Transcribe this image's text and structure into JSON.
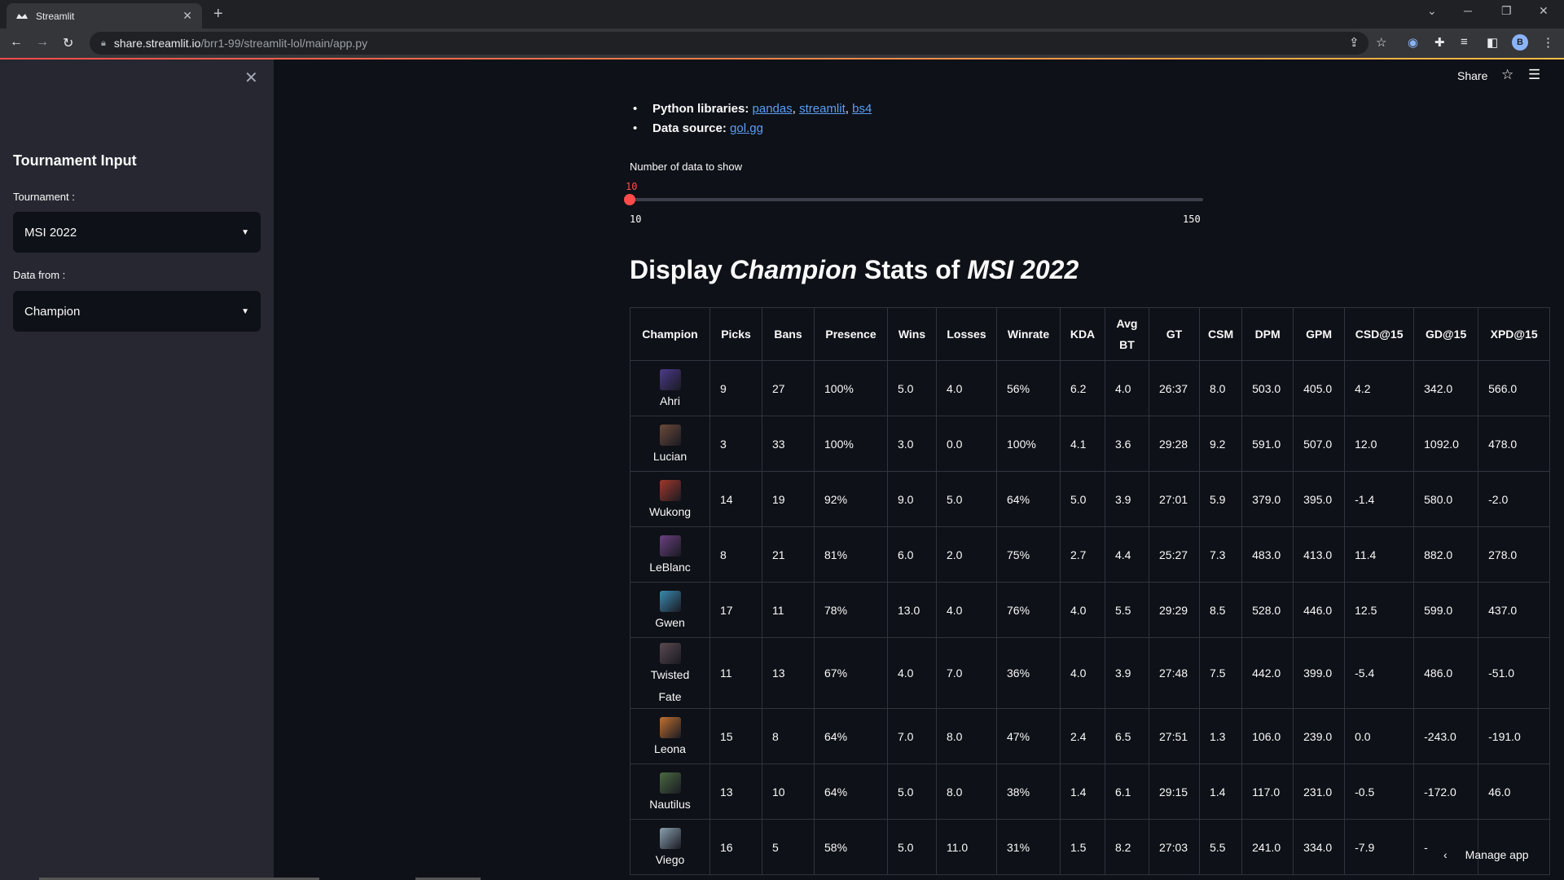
{
  "browser": {
    "tab_title": "Streamlit",
    "url_host": "share.streamlit.io",
    "url_path": "/brr1-99/streamlit-lol/main/app.py",
    "profile_initial": "B"
  },
  "sidebar": {
    "title": "Tournament Input",
    "tournament_label": "Tournament :",
    "tournament_value": "MSI 2022",
    "data_from_label": "Data from :",
    "data_from_value": "Champion"
  },
  "header": {
    "share_label": "Share"
  },
  "info": {
    "libraries_label": "Python libraries:",
    "lib1": "pandas",
    "lib2": "streamlit",
    "lib3": "bs4",
    "comma": ",",
    "source_label": "Data source:",
    "source_link": "gol.gg"
  },
  "slider": {
    "label": "Number of data to show",
    "value": "10",
    "min": "10",
    "max": "150",
    "fraction": 0
  },
  "heading": {
    "prefix": "Display ",
    "entity": "Champion",
    "middle": " Stats of ",
    "tournament": "MSI 2022"
  },
  "table": {
    "columns": [
      "Champion",
      "Picks",
      "Bans",
      "Presence",
      "Wins",
      "Losses",
      "Winrate",
      "KDA",
      "Avg BT",
      "GT",
      "CSM",
      "DPM",
      "GPM",
      "CSD@15",
      "GD@15",
      "XPD@15"
    ],
    "rows": [
      {
        "champion": "Ahri",
        "portrait": "#4b3a8a",
        "cells": [
          "9",
          "27",
          "100%",
          "5.0",
          "4.0",
          "56%",
          "6.2",
          "4.0",
          "26:37",
          "8.0",
          "503.0",
          "405.0",
          "4.2",
          "342.0",
          "566.0"
        ]
      },
      {
        "champion": "Lucian",
        "portrait": "#6b4a3a",
        "cells": [
          "3",
          "33",
          "100%",
          "3.0",
          "0.0",
          "100%",
          "4.1",
          "3.6",
          "29:28",
          "9.2",
          "591.0",
          "507.0",
          "12.0",
          "1092.0",
          "478.0"
        ]
      },
      {
        "champion": "Wukong",
        "portrait": "#a0382a",
        "cells": [
          "14",
          "19",
          "92%",
          "9.0",
          "5.0",
          "64%",
          "5.0",
          "3.9",
          "27:01",
          "5.9",
          "379.0",
          "395.0",
          "-1.4",
          "580.0",
          "-2.0"
        ]
      },
      {
        "champion": "LeBlanc",
        "portrait": "#6a4080",
        "cells": [
          "8",
          "21",
          "81%",
          "6.0",
          "2.0",
          "75%",
          "2.7",
          "4.4",
          "25:27",
          "7.3",
          "483.0",
          "413.0",
          "11.4",
          "882.0",
          "278.0"
        ]
      },
      {
        "champion": "Gwen",
        "portrait": "#3a8ab0",
        "cells": [
          "17",
          "11",
          "78%",
          "13.0",
          "4.0",
          "76%",
          "4.0",
          "5.5",
          "29:29",
          "8.5",
          "528.0",
          "446.0",
          "12.5",
          "599.0",
          "437.0"
        ]
      },
      {
        "champion": "Twisted Fate",
        "portrait": "#5a4a50",
        "cells": [
          "11",
          "13",
          "67%",
          "4.0",
          "7.0",
          "36%",
          "4.0",
          "3.9",
          "27:48",
          "7.5",
          "442.0",
          "399.0",
          "-5.4",
          "486.0",
          "-51.0"
        ]
      },
      {
        "champion": "Leona",
        "portrait": "#c07030",
        "cells": [
          "15",
          "8",
          "64%",
          "7.0",
          "8.0",
          "47%",
          "2.4",
          "6.5",
          "27:51",
          "1.3",
          "106.0",
          "239.0",
          "0.0",
          "-243.0",
          "-191.0"
        ]
      },
      {
        "champion": "Nautilus",
        "portrait": "#4a6a40",
        "cells": [
          "13",
          "10",
          "64%",
          "5.0",
          "8.0",
          "38%",
          "1.4",
          "6.1",
          "29:15",
          "1.4",
          "117.0",
          "231.0",
          "-0.5",
          "-172.0",
          "46.0"
        ]
      },
      {
        "champion": "Viego",
        "portrait": "#8aa0b0",
        "cells": [
          "16",
          "5",
          "58%",
          "5.0",
          "11.0",
          "31%",
          "1.5",
          "8.2",
          "27:03",
          "5.5",
          "241.0",
          "334.0",
          "-7.9",
          "-",
          ""
        ]
      }
    ]
  },
  "footer": {
    "manage_app": "Manage app"
  },
  "colors": {
    "accent": "#ff4b4b",
    "link": "#5c9df5",
    "sidebar_bg": "#262730",
    "main_bg": "#0e1117"
  }
}
